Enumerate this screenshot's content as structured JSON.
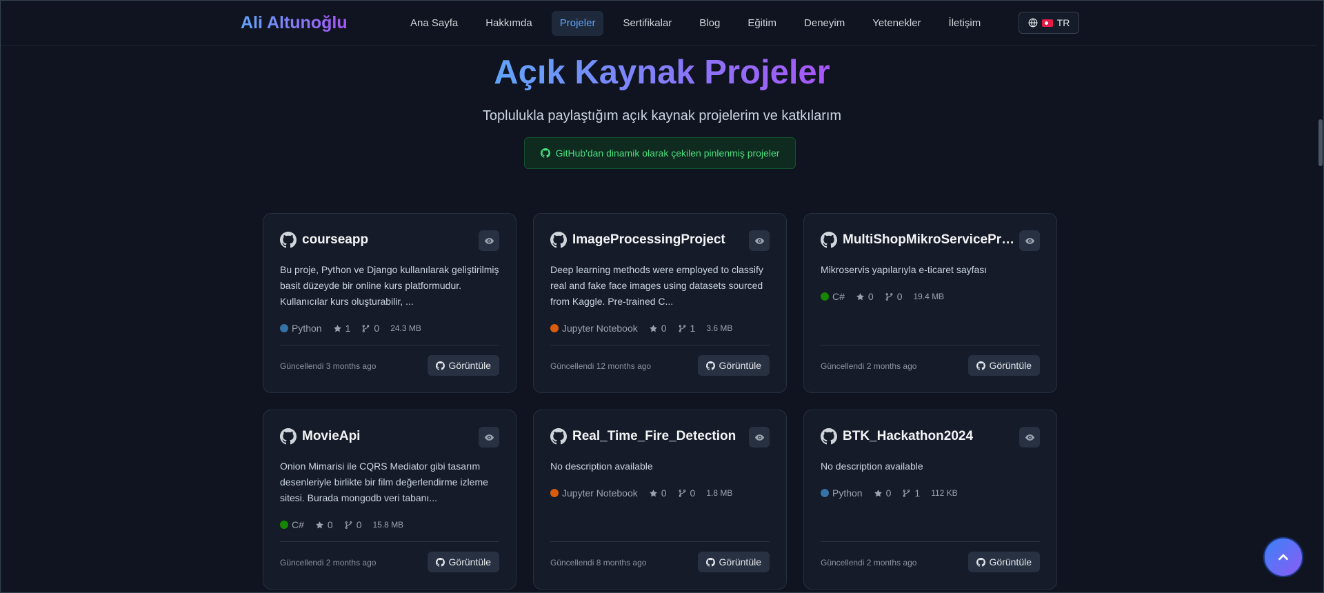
{
  "nav": {
    "brand": "Ali Altunoğlu",
    "links": [
      {
        "label": "Ana Sayfa",
        "active": false
      },
      {
        "label": "Hakkımda",
        "active": false
      },
      {
        "label": "Projeler",
        "active": true
      },
      {
        "label": "Sertifikalar",
        "active": false
      },
      {
        "label": "Blog",
        "active": false
      },
      {
        "label": "Eğitim",
        "active": false
      },
      {
        "label": "Deneyim",
        "active": false
      },
      {
        "label": "Yetenekler",
        "active": false
      },
      {
        "label": "İletişim",
        "active": false
      }
    ],
    "language": "TR"
  },
  "hero": {
    "title": "Açık Kaynak Projeler",
    "subtitle": "Toplulukla paylaştığım açık kaynak projelerim ve katkılarım",
    "badge": "GitHub'dan dinamik olarak çekilen pinlenmiş projeler"
  },
  "colors": {
    "accent_start": "#60a5fa",
    "accent_end": "#a855f7",
    "python": "#3572A5",
    "jupyter": "#DA5B0B",
    "csharp": "#178600"
  },
  "projects": [
    {
      "name": "courseapp",
      "description": "Bu proje, Python ve Django kullanılarak geliştirilmiş basit düzeyde bir online kurs platformudur. Kullanıcılar kurs oluşturabilir, ...",
      "language": "Python",
      "language_color": "#3572A5",
      "stars": "1",
      "forks": "0",
      "size": "24.3 MB",
      "updated": "Güncellendi 3 months ago",
      "view_label": "Görüntüle"
    },
    {
      "name": "ImageProcessingProject",
      "description": "Deep learning methods were employed to classify real and fake face images using datasets sourced from Kaggle. Pre-trained C...",
      "language": "Jupyter Notebook",
      "language_color": "#DA5B0B",
      "stars": "0",
      "forks": "1",
      "size": "3.6 MB",
      "updated": "Güncellendi 12 months ago",
      "view_label": "Görüntüle"
    },
    {
      "name": "MultiShopMikroServiceProject",
      "description": "Mikroservis yapılarıyla e-ticaret sayfası",
      "language": "C#",
      "language_color": "#178600",
      "stars": "0",
      "forks": "0",
      "size": "19.4 MB",
      "updated": "Güncellendi 2 months ago",
      "view_label": "Görüntüle"
    },
    {
      "name": "MovieApi",
      "description": "Onion Mimarisi ile CQRS Mediator gibi tasarım desenleriyle birlikte bir film değerlendirme izleme sitesi. Burada mongodb veri tabanı...",
      "language": "C#",
      "language_color": "#178600",
      "stars": "0",
      "forks": "0",
      "size": "15.8 MB",
      "updated": "Güncellendi 2 months ago",
      "view_label": "Görüntüle"
    },
    {
      "name": "Real_Time_Fire_Detection",
      "description": "No description available",
      "language": "Jupyter Notebook",
      "language_color": "#DA5B0B",
      "stars": "0",
      "forks": "0",
      "size": "1.8 MB",
      "updated": "Güncellendi 8 months ago",
      "view_label": "Görüntüle"
    },
    {
      "name": "BTK_Hackathon2024",
      "description": "No description available",
      "language": "Python",
      "language_color": "#3572A5",
      "stars": "0",
      "forks": "1",
      "size": "112 KB",
      "updated": "Güncellendi 2 months ago",
      "view_label": "Görüntüle"
    }
  ]
}
